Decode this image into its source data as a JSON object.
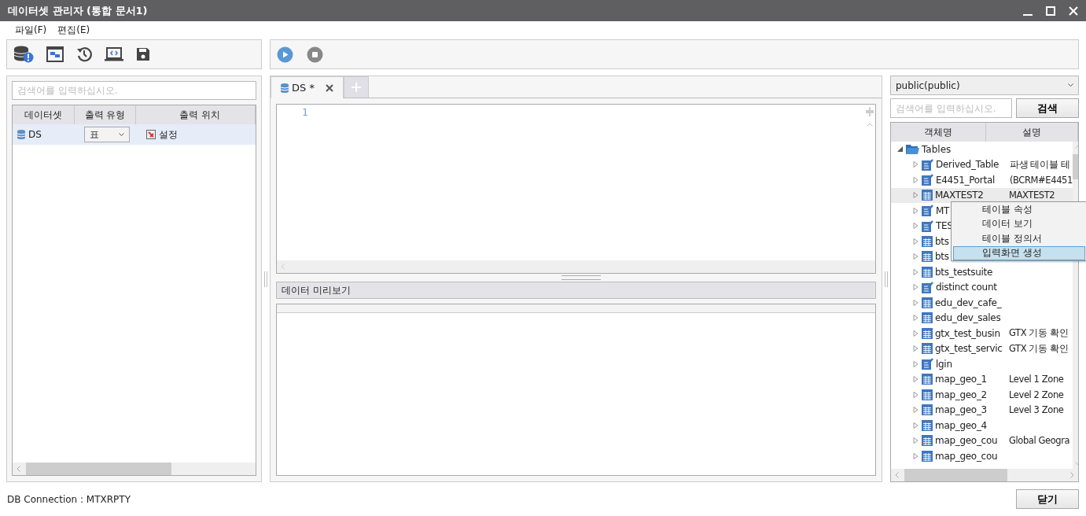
{
  "window": {
    "title": "데이터셋 관리자 (통합 문서1)"
  },
  "menu": [
    "파일(F)",
    "편집(E)"
  ],
  "dataset_panel": {
    "search": {
      "placeholder": "검색어를 입력하십시오."
    },
    "columns": [
      "데이터셋",
      "출력 유형",
      "출력 위치"
    ],
    "rows": [
      {
        "name": "DS",
        "output_type": "표",
        "output_location": "설정",
        "selected": true
      }
    ]
  },
  "editor": {
    "tabs": [
      {
        "label": "DS *",
        "selected": true
      }
    ],
    "line_numbers": [
      "1"
    ],
    "preview_title": "데이터 미리보기"
  },
  "schema_panel": {
    "schema": "public(public)",
    "search": {
      "placeholder": "검색어를 입력하십시오."
    },
    "search_button": "검색",
    "columns": [
      "객체명",
      "설명"
    ],
    "tree": [
      {
        "label": "Tables",
        "expanded": true,
        "children": [
          {
            "label": "Derived_Table",
            "description": "파생 테이블 테",
            "kind": "view",
            "expanded": false,
            "selected": false
          },
          {
            "label": "E4451_Portal",
            "description": "(BCRM#E4451",
            "kind": "view",
            "expanded": false,
            "selected": false
          },
          {
            "label": "MAXTEST2",
            "description": "MAXTEST2",
            "kind": "table",
            "expanded": false,
            "selected": true
          },
          {
            "label": "MT",
            "kind": "view",
            "expanded": false,
            "selected": false
          },
          {
            "label": "TES",
            "kind": "view",
            "expanded": false,
            "selected": false
          },
          {
            "label": "bts",
            "kind": "table",
            "expanded": false,
            "selected": false
          },
          {
            "label": "bts",
            "kind": "table",
            "expanded": false,
            "selected": false
          },
          {
            "label": "bts_testsuite",
            "kind": "table",
            "expanded": false,
            "selected": false
          },
          {
            "label": "distinct count",
            "kind": "view",
            "expanded": false,
            "selected": false
          },
          {
            "label": "edu_dev_cafe_",
            "kind": "table",
            "expanded": false,
            "selected": false
          },
          {
            "label": "edu_dev_sales",
            "kind": "table",
            "expanded": false,
            "selected": false
          },
          {
            "label": "gtx_test_busin",
            "description": "GTX 기동 확인",
            "kind": "table",
            "expanded": false,
            "selected": false
          },
          {
            "label": "gtx_test_servic",
            "description": "GTX 기동 확인",
            "kind": "table",
            "expanded": false,
            "selected": false
          },
          {
            "label": "lgin",
            "kind": "view",
            "expanded": false,
            "selected": false
          },
          {
            "label": "map_geo_1",
            "description": "Level 1 Zone",
            "kind": "table",
            "expanded": false,
            "selected": false
          },
          {
            "label": "map_geo_2",
            "description": "Level 2 Zone",
            "kind": "table",
            "expanded": false,
            "selected": false
          },
          {
            "label": "map_geo_3",
            "description": "Level 3 Zone",
            "kind": "table",
            "expanded": false,
            "selected": false
          },
          {
            "label": "map_geo_4",
            "kind": "table",
            "expanded": false,
            "selected": false
          },
          {
            "label": "map_geo_cou",
            "description": "Global Geogra",
            "kind": "table",
            "expanded": false,
            "selected": false
          },
          {
            "label": "map_geo_cou",
            "kind": "table",
            "expanded": false,
            "selected": false
          }
        ]
      }
    ]
  },
  "context_menu": [
    {
      "label": "테이블 속성",
      "selected": false
    },
    {
      "label": "데이터 보기",
      "selected": false
    },
    {
      "label": "테이블 정의서",
      "selected": false
    },
    {
      "label": "입력화면 생성",
      "selected": true
    }
  ],
  "status_bar": "DB Connection : MTXRPTY",
  "close_button": "닫기"
}
